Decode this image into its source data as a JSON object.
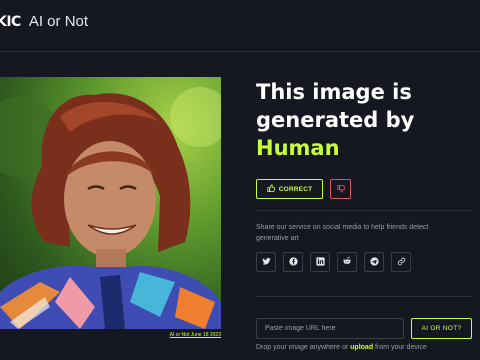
{
  "header": {
    "logo_mark": "KIC",
    "app_name": "AI or Not"
  },
  "photo": {
    "caption": "AI or Not June 18 2023"
  },
  "result": {
    "headline_line1": "This image is",
    "headline_line2": "generated by",
    "verdict": "Human",
    "correct_label": "CORRECT"
  },
  "share": {
    "text": "Share our service on social media to help friends detect generative art",
    "icons": [
      "twitter-icon",
      "facebook-icon",
      "linkedin-icon",
      "reddit-icon",
      "telegram-icon",
      "link-icon"
    ]
  },
  "check": {
    "placeholder": "Paste image URL here",
    "button_label": "AI OR NOT?",
    "drop_prefix": "Drop your image anywhere or ",
    "drop_link": "upload",
    "drop_suffix": " from your device"
  },
  "colors": {
    "background": "#161821",
    "accent": "#c6ff3a",
    "danger": "#e0505e",
    "muted": "#9a9ca6"
  }
}
